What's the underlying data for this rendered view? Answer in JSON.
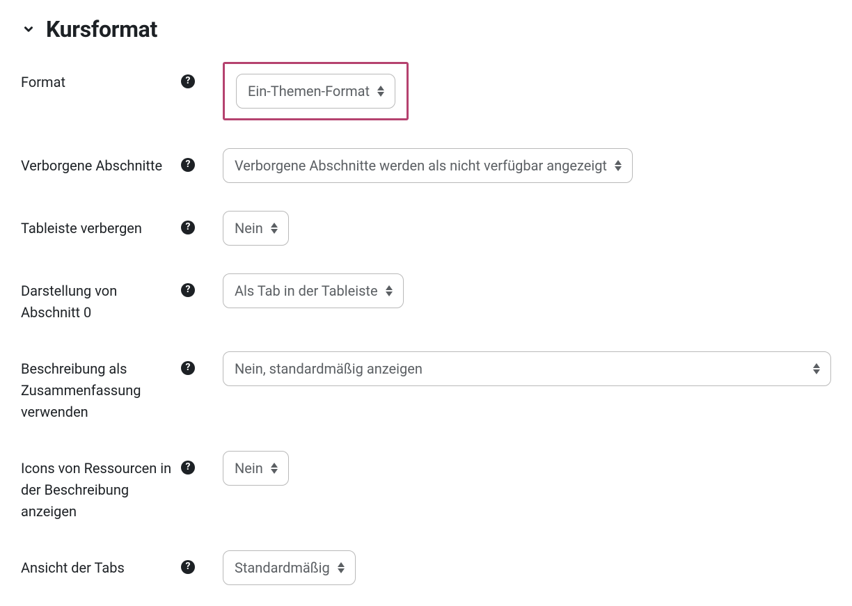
{
  "section": {
    "title": "Kursformat"
  },
  "rows": {
    "format": {
      "label": "Format",
      "value": "Ein-Themen-Format"
    },
    "hidden_sections": {
      "label": "Verborgene Abschnitte",
      "value": "Verborgene Abschnitte werden als nicht verfügbar angezeigt"
    },
    "hide_tabbar": {
      "label": "Tableiste verbergen",
      "value": "Nein"
    },
    "section0_display": {
      "label": "Darstellung von Abschnitt 0",
      "value": "Als Tab in der Tableiste"
    },
    "description_as_summary": {
      "label": "Beschreibung als Zusammenfassung verwenden",
      "value": "Nein, standardmäßig anzeigen"
    },
    "resource_icons": {
      "label": "Icons von Ressourcen in der Beschreibung anzeigen",
      "value": "Nein"
    },
    "tab_view": {
      "label": "Ansicht der Tabs",
      "value": "Standardmäßig"
    }
  }
}
